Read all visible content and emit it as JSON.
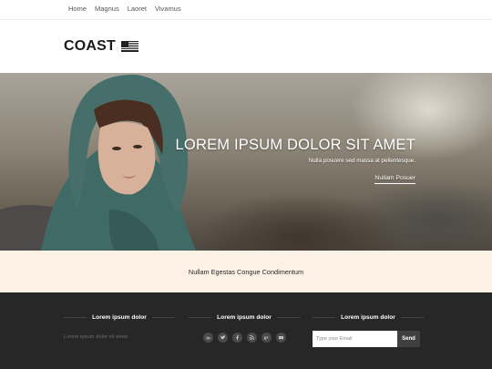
{
  "nav": {
    "items": [
      {
        "label": "Home"
      },
      {
        "label": "Magnus"
      },
      {
        "label": "Laoret"
      },
      {
        "label": "Vivamus"
      }
    ]
  },
  "brand": {
    "logo_text": "COAST",
    "flag_icon": "us-flag-icon"
  },
  "hero": {
    "title": "LOREM IPSUM DOLOR SIT AMET",
    "subtitle": "Nulla posuere sed massa at pellentesque.",
    "link_label": "Nullam Posuer"
  },
  "promo": {
    "text": "Nullam Egestas Congue Condimentum"
  },
  "footer": {
    "col1": {
      "title": "Lorem ipsum dolor",
      "text": "Lorem ipsum dolor sit amet."
    },
    "col2": {
      "title": "Lorem ipsum dolor",
      "social_icons": [
        "linkedin-icon",
        "twitter-icon",
        "facebook-icon",
        "rss-icon",
        "google-plus-icon",
        "youtube-icon"
      ]
    },
    "col3": {
      "title": "Lorem ipsum dolor",
      "email_placeholder": "Type your Email",
      "send_label": "Send"
    }
  },
  "colors": {
    "promo_bg": "#fbf1e4",
    "footer_bg": "#272727",
    "scarf": "#3f6a66"
  }
}
